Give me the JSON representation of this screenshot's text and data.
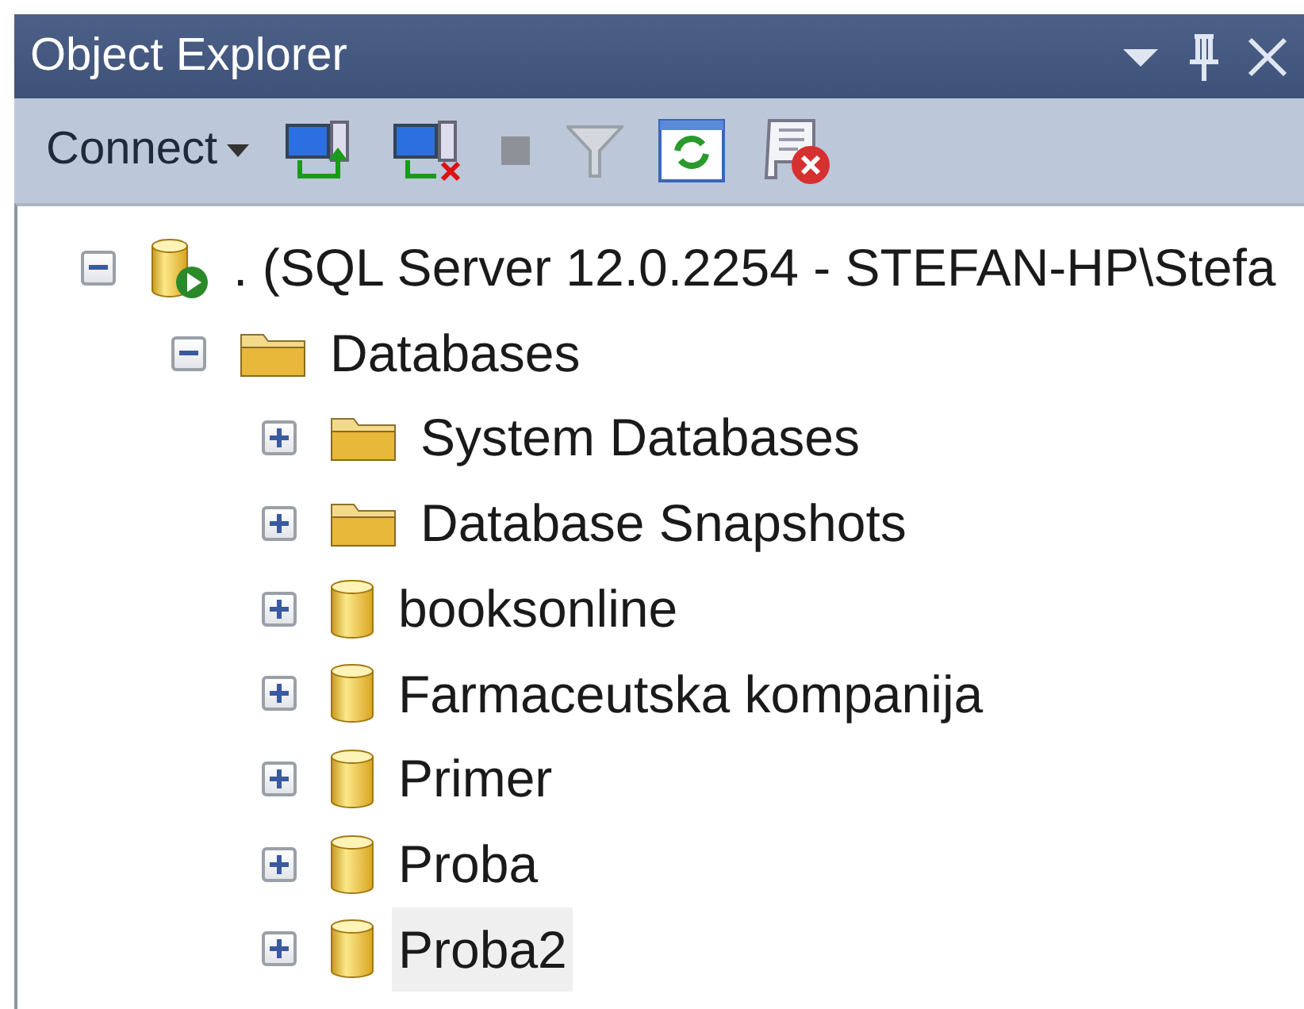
{
  "window": {
    "title": "Object Explorer"
  },
  "toolbar": {
    "connect_label": "Connect"
  },
  "tree": [
    {
      "kind": "server",
      "label": ". (SQL Server 12.0.2254 - STEFAN-HP\\Stefa",
      "expanded": true,
      "selected": false,
      "children": [
        {
          "kind": "folder",
          "label": "Databases",
          "expanded": true,
          "selected": false,
          "children": [
            {
              "kind": "folder",
              "label": "System Databases",
              "expanded": false,
              "selected": false
            },
            {
              "kind": "folder",
              "label": "Database Snapshots",
              "expanded": false,
              "selected": false
            },
            {
              "kind": "database",
              "label": "booksonline",
              "expanded": false,
              "selected": false
            },
            {
              "kind": "database",
              "label": "Farmaceutska kompanija",
              "expanded": false,
              "selected": false
            },
            {
              "kind": "database",
              "label": "Primer",
              "expanded": false,
              "selected": false
            },
            {
              "kind": "database",
              "label": "Proba",
              "expanded": false,
              "selected": false
            },
            {
              "kind": "database",
              "label": "Proba2",
              "expanded": false,
              "selected": true
            }
          ]
        }
      ]
    }
  ]
}
